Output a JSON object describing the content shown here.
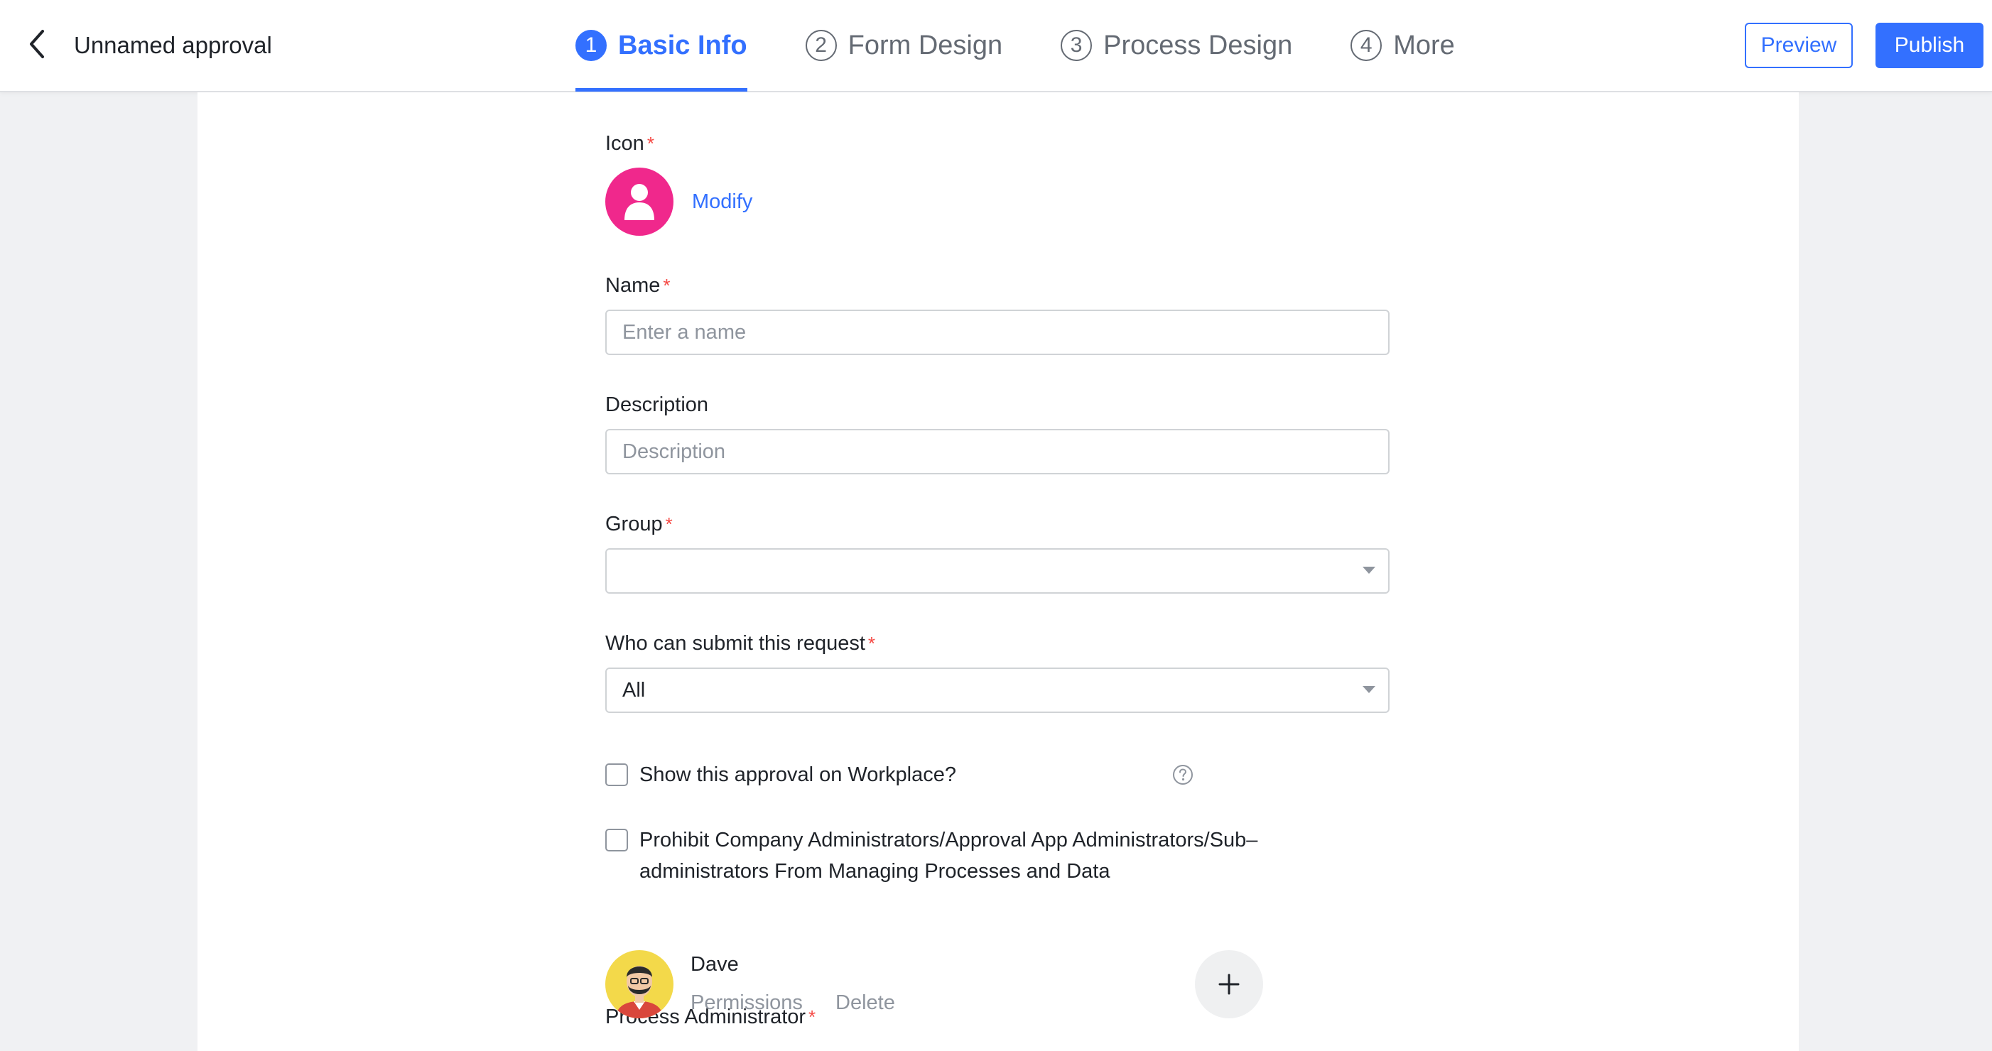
{
  "header": {
    "title": "Unnamed approval",
    "steps": [
      {
        "number": "1",
        "label": "Basic Info",
        "active": true
      },
      {
        "number": "2",
        "label": "Form Design",
        "active": false
      },
      {
        "number": "3",
        "label": "Process Design",
        "active": false
      },
      {
        "number": "4",
        "label": "More",
        "active": false
      }
    ],
    "preview_label": "Preview",
    "publish_label": "Publish"
  },
  "form": {
    "icon": {
      "label": "Icon",
      "required_mark": "*",
      "modify_label": "Modify",
      "color": "#f0288c",
      "icon_name": "person-icon"
    },
    "name": {
      "label": "Name",
      "required_mark": "*",
      "value": "",
      "placeholder": "Enter a name"
    },
    "description": {
      "label": "Description",
      "value": "",
      "placeholder": "Description"
    },
    "group": {
      "label": "Group",
      "required_mark": "*",
      "value": ""
    },
    "submitters": {
      "label": "Who can submit this request",
      "required_mark": "*",
      "value": "All"
    },
    "show_on_workplace": {
      "label": "Show this approval on Workplace?",
      "checked": false
    },
    "prohibit_admins": {
      "line1": "Prohibit Company Administrators/Approval App Administrators/Sub–",
      "line2": "administrators From Managing Processes and Data",
      "checked": false
    },
    "process_admin": {
      "label": "Process Administrator",
      "required_mark": "*",
      "admins": [
        {
          "name": "Dave",
          "permissions_label": "Permissions",
          "delete_label": "Delete"
        }
      ]
    }
  },
  "colors": {
    "accent": "#3370ff",
    "required": "#f54a45",
    "muted": "#8f959e"
  }
}
